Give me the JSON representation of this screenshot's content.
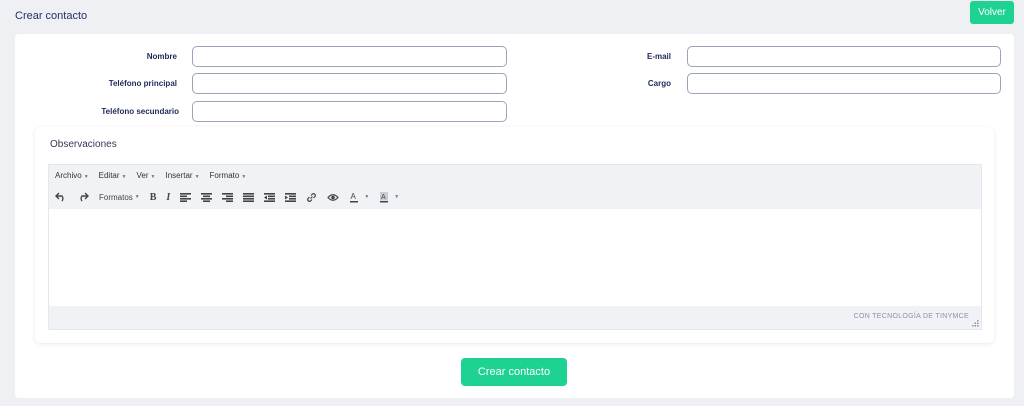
{
  "header": {
    "title": "Crear contacto",
    "back_label": "Volver"
  },
  "form": {
    "nombre_label": "Nombre",
    "email_label": "E-mail",
    "telefono_principal_label": "Teléfono principal",
    "cargo_label": "Cargo",
    "telefono_secundario_label": "Teléfono secundario"
  },
  "observaciones": {
    "title": "Observaciones",
    "menu": [
      "Archivo",
      "Editar",
      "Ver",
      "Insertar",
      "Formato"
    ],
    "formats_label": "Formatos",
    "branding": "CON TECNOLOGÍA DE TINYMCE"
  },
  "submit_label": "Crear contacto",
  "colors": {
    "accent": "#1ed291",
    "title": "#23306b"
  }
}
